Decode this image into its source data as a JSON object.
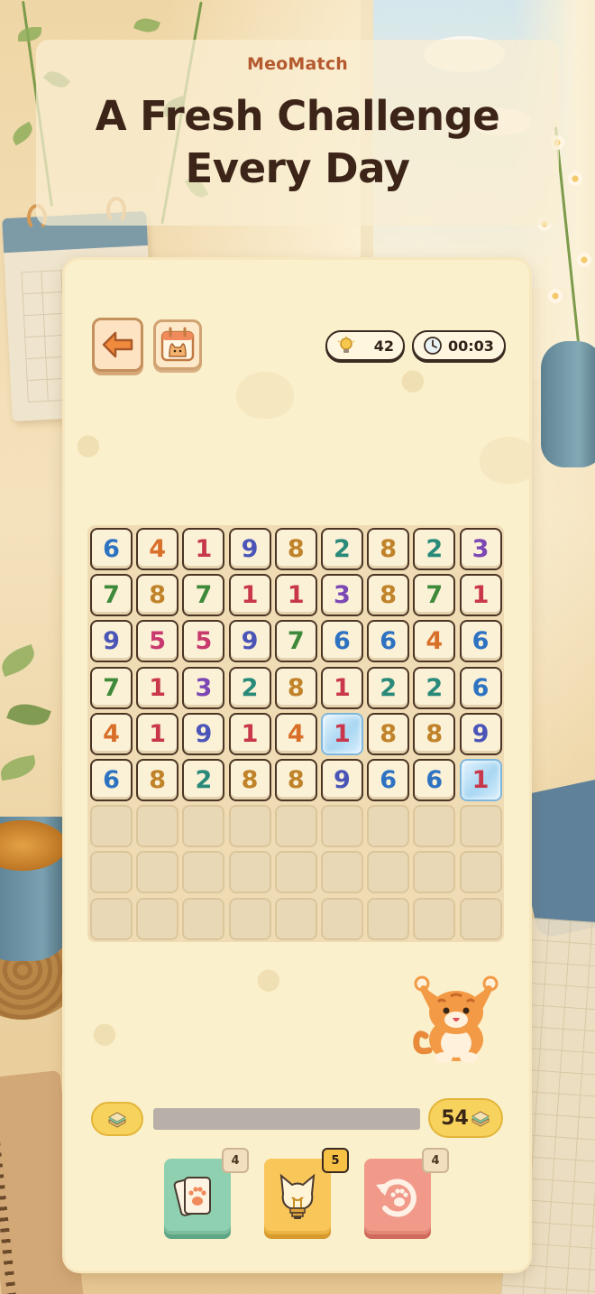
{
  "header": {
    "brand": "MeoMatch",
    "headline_line1": "A Fresh Challenge",
    "headline_line2": "Every Day"
  },
  "toolbar": {
    "back_icon": "arrow-left-icon",
    "calendar_icon": "cat-calendar-icon",
    "hints_count": "42",
    "hints_icon": "lightbulb-icon",
    "timer": "00:03",
    "timer_icon": "clock-icon"
  },
  "board": {
    "columns": 9,
    "rows": [
      [
        "6",
        "4",
        "1",
        "9",
        "8",
        "2",
        "8",
        "2",
        "3"
      ],
      [
        "7",
        "8",
        "7",
        "1",
        "1",
        "3",
        "8",
        "7",
        "1"
      ],
      [
        "9",
        "5",
        "5",
        "9",
        "7",
        "6",
        "6",
        "4",
        "6"
      ],
      [
        "7",
        "1",
        "3",
        "2",
        "8",
        "1",
        "2",
        "2",
        "6"
      ],
      [
        "4",
        "1",
        "9",
        "1",
        "4",
        "1",
        "8",
        "8",
        "9"
      ],
      [
        "6",
        "8",
        "2",
        "8",
        "8",
        "9",
        "6",
        "6",
        "1"
      ],
      [
        "",
        "",
        "",
        "",
        "",
        "",
        "",
        "",
        ""
      ],
      [
        "",
        "",
        "",
        "",
        "",
        "",
        "",
        "",
        ""
      ],
      [
        "",
        "",
        "",
        "",
        "",
        "",
        "",
        "",
        ""
      ]
    ],
    "frozen_cells": [
      [
        4,
        5
      ],
      [
        5,
        8
      ]
    ],
    "digit_colors": {
      "1": "#c8384a",
      "2": "#2a8a7a",
      "3": "#7b48b4",
      "4": "#d8702a",
      "5": "#c83a6e",
      "6": "#2e73c2",
      "7": "#3f8a3a",
      "8": "#c0832a",
      "9": "#4b55b8"
    }
  },
  "progress": {
    "fraction": 0.0,
    "gem_total": "54",
    "gem_icon": "sandwich-gem-icon"
  },
  "powerups": [
    {
      "name": "shuffle",
      "icon": "paw-cards-icon",
      "count": "4"
    },
    {
      "name": "hint",
      "icon": "cat-lightbulb-icon",
      "count": "5"
    },
    {
      "name": "undo",
      "icon": "paw-undo-icon",
      "count": "4"
    }
  ],
  "colors": {
    "card": "#fbf0cc",
    "brand": "#b5592f",
    "headline": "#3c2418"
  }
}
